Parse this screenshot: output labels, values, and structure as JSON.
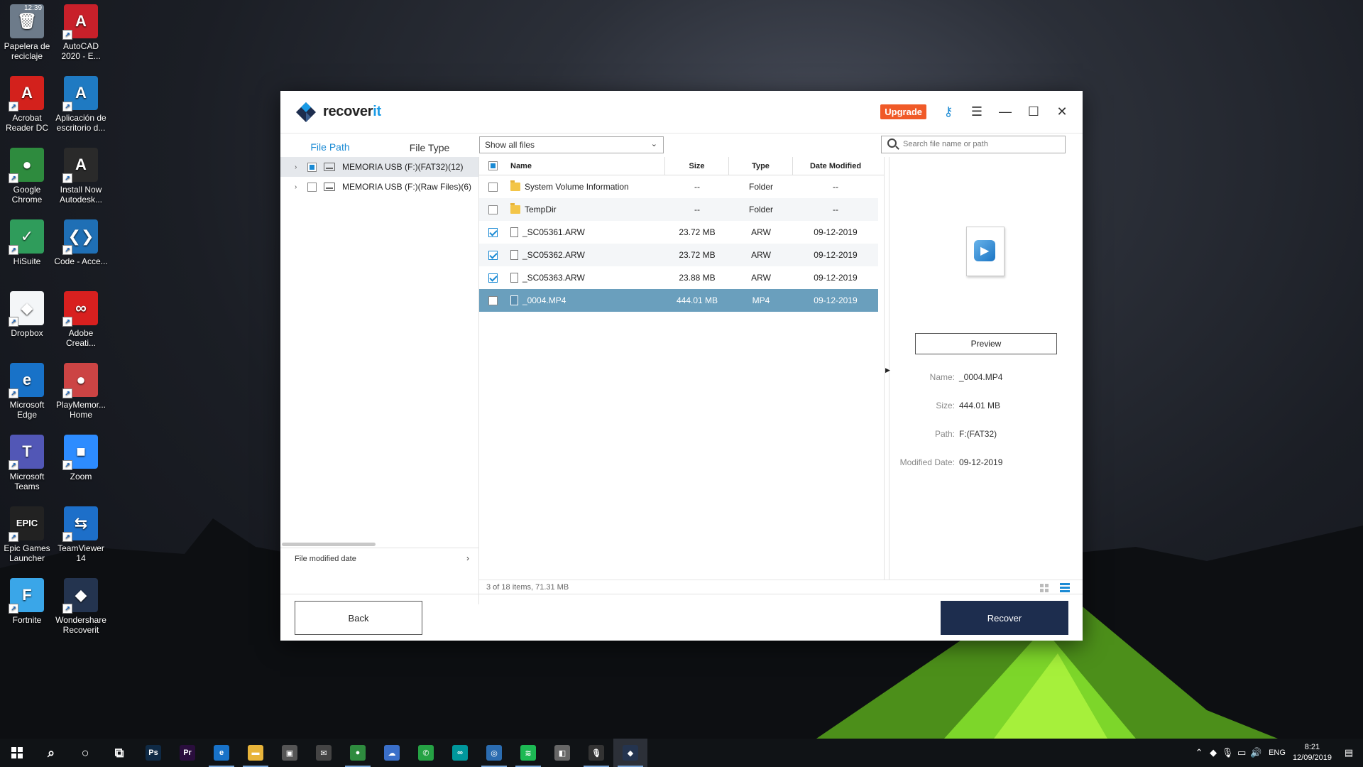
{
  "desktop": {
    "icons": [
      {
        "label": "Papelera de reciclaje",
        "glyph": "🗑",
        "color": "#6d7b8a"
      },
      {
        "label": "AutoCAD 2020 - E...",
        "glyph": "A",
        "color": "#c8202a"
      },
      {
        "label": "Acrobat Reader DC",
        "glyph": "A",
        "color": "#d3211c"
      },
      {
        "label": "Aplicación de escritorio d...",
        "glyph": "A",
        "color": "#1f7ac2"
      },
      {
        "label": "Google Chrome",
        "glyph": "●",
        "color": "#2e8b3e"
      },
      {
        "label": "Install Now Autodesk...",
        "glyph": "A",
        "color": "#2a2a2a"
      },
      {
        "label": "HiSuite",
        "glyph": "✓",
        "color": "#2f9c5b"
      },
      {
        "label": "Code - Acce...",
        "glyph": "❮❯",
        "color": "#1f6fb5"
      },
      {
        "label": "Dropbox",
        "glyph": "◆",
        "color": "#f4f6f8"
      },
      {
        "label": "Adobe Creati...",
        "glyph": "∞",
        "color": "#d8201f"
      },
      {
        "label": "Microsoft Edge",
        "glyph": "e",
        "color": "#1872c8"
      },
      {
        "label": "PlayMemor... Home",
        "glyph": "●",
        "color": "#c44"
      },
      {
        "label": "Microsoft Teams",
        "glyph": "T",
        "color": "#5257b6"
      },
      {
        "label": "Zoom",
        "glyph": "■",
        "color": "#2d8cff"
      },
      {
        "label": "Epic Games Launcher",
        "glyph": "EPIC",
        "color": "#222"
      },
      {
        "label": "TeamViewer 14",
        "glyph": "⇆",
        "color": "#1d6fc9"
      },
      {
        "label": "Fortnite",
        "glyph": "F",
        "color": "#3aa6e8"
      },
      {
        "label": "Wondershare Recoverit",
        "glyph": "◆",
        "color": "#24344f"
      }
    ],
    "top_clock": "12:39"
  },
  "app": {
    "brand_prefix": "recover",
    "brand_suffix": "it",
    "upgrade_label": "Upgrade",
    "tabs": {
      "file_path": "File Path",
      "file_type": "File Type"
    },
    "filter_value": "Show all files",
    "search_placeholder": "Search file name or path",
    "tree": [
      {
        "label": "MEMORIA USB (F:)(FAT32)(12)",
        "selected": true,
        "state": "partial"
      },
      {
        "label": "MEMORIA USB (F:)(Raw Files)(6)",
        "selected": false,
        "state": "none"
      }
    ],
    "tree_footer": "File modified date",
    "columns": {
      "name": "Name",
      "size": "Size",
      "type": "Type",
      "date": "Date Modified"
    },
    "files": [
      {
        "name": "System Volume Information",
        "size": "--",
        "type": "Folder",
        "date": "--",
        "checked": false,
        "kind": "folder"
      },
      {
        "name": "TempDir",
        "size": "--",
        "type": "Folder",
        "date": "--",
        "checked": false,
        "kind": "folder"
      },
      {
        "name": "_SC05361.ARW",
        "size": "23.72  MB",
        "type": "ARW",
        "date": "09-12-2019",
        "checked": true,
        "kind": "file"
      },
      {
        "name": "_SC05362.ARW",
        "size": "23.72  MB",
        "type": "ARW",
        "date": "09-12-2019",
        "checked": true,
        "kind": "file"
      },
      {
        "name": "_SC05363.ARW",
        "size": "23.88  MB",
        "type": "ARW",
        "date": "09-12-2019",
        "checked": true,
        "kind": "file"
      },
      {
        "name": "_0004.MP4",
        "size": "444.01  MB",
        "type": "MP4",
        "date": "09-12-2019",
        "checked": false,
        "kind": "video",
        "selected": true
      }
    ],
    "status": "3 of 18 items, 71.31  MB",
    "preview": {
      "button": "Preview",
      "name_label": "Name:",
      "name_value": "_0004.MP4",
      "size_label": "Size:",
      "size_value": "444.01  MB",
      "path_label": "Path:",
      "path_value": "F:(FAT32)",
      "date_label": "Modified Date:",
      "date_value": "09-12-2019"
    },
    "back_label": "Back",
    "recover_label": "Recover"
  },
  "taskbar": {
    "apps": [
      {
        "name": "search-icon",
        "glyph": "⌕",
        "color": "transparent"
      },
      {
        "name": "cortana-icon",
        "glyph": "○",
        "color": "transparent"
      },
      {
        "name": "task-view-icon",
        "glyph": "⧉",
        "color": "transparent"
      },
      {
        "name": "photoshop-icon",
        "glyph": "Ps",
        "color": "#0f2a45"
      },
      {
        "name": "premiere-icon",
        "glyph": "Pr",
        "color": "#2a0e3d"
      },
      {
        "name": "edge-icon",
        "glyph": "e",
        "color": "#1872c8"
      },
      {
        "name": "file-explorer-icon",
        "glyph": "▬",
        "color": "#e8b43a"
      },
      {
        "name": "store-icon",
        "glyph": "▣",
        "color": "#555"
      },
      {
        "name": "mail-icon",
        "glyph": "✉",
        "color": "#444"
      },
      {
        "name": "chrome-icon",
        "glyph": "●",
        "color": "#2e8b3e"
      },
      {
        "name": "cloud-app-icon",
        "glyph": "☁",
        "color": "#3a6fc9"
      },
      {
        "name": "whatsapp-icon",
        "glyph": "✆",
        "color": "#25a244"
      },
      {
        "name": "arduino-icon",
        "glyph": "∞",
        "color": "#00979c"
      },
      {
        "name": "notifications-app-icon",
        "glyph": "◎",
        "color": "#2b6cb0"
      },
      {
        "name": "spotify-icon",
        "glyph": "≋",
        "color": "#1db954"
      },
      {
        "name": "camera-app-icon",
        "glyph": "◧",
        "color": "#666"
      },
      {
        "name": "microphone-app-icon",
        "glyph": "🎙",
        "color": "#333"
      },
      {
        "name": "recoverit-taskbar-icon",
        "glyph": "◆",
        "color": "#24344f"
      }
    ],
    "language": "ENG",
    "time": "8:21",
    "date": "12/09/2019"
  }
}
